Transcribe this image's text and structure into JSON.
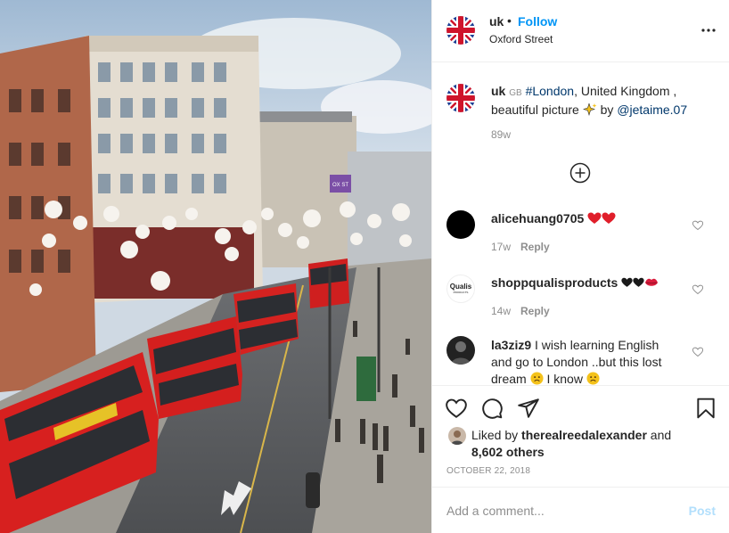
{
  "post": {
    "username": "uk",
    "follow_separator": "•",
    "follow_label": "Follow",
    "location": "Oxford Street",
    "more_icon": "more-horizontal-icon",
    "avatar_icon": "union-jack-flag"
  },
  "caption": {
    "username": "uk",
    "country_tag": "GB",
    "hashtag": "#London",
    "text_1": ", United Kingdom ,",
    "text_2": "beautiful picture",
    "emoji": "sparkles",
    "by_text": "by",
    "mention": "@jetaime.07",
    "time": "89w"
  },
  "load_more_icon": "plus-circle-icon",
  "comments": [
    {
      "username": "alicehuang0705",
      "text": "",
      "emojis": "two red hearts",
      "time": "17w",
      "reply_label": "Reply"
    },
    {
      "username": "shoppqualisproducts",
      "text": "",
      "emojis": "two black hearts and lips",
      "avatar_text": "Qualis",
      "avatar_subtext": "PRODUCTS",
      "time": "14w",
      "reply_label": "Reply"
    },
    {
      "username": "la3ziz9",
      "text_1": "I wish learning English",
      "text_2": "and go to London ..but this lost",
      "text_3": "dream",
      "text_4": "I know"
    }
  ],
  "likes": {
    "prefix": "Liked by",
    "liker": "therealreedalexander",
    "and": "and",
    "count": "8,602 others"
  },
  "date": "OCTOBER 22, 2018",
  "add_comment": {
    "placeholder": "Add a comment...",
    "post_label": "Post"
  },
  "photo": {
    "description_icon": "oxford-street-photo",
    "sign_text": "OX ST"
  },
  "colors": {
    "follow_blue": "#0095f6",
    "link_blue": "#00376b",
    "heart_red": "#ed4956",
    "post_disabled": "#b2dffc",
    "grey": "#8e8e8e"
  }
}
